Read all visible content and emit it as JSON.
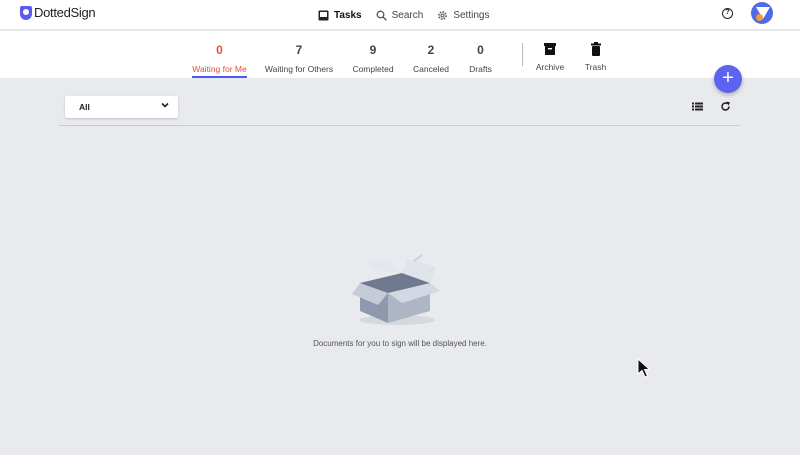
{
  "app": {
    "logo_prefix": "Dotted",
    "logo_suffix": "Sign"
  },
  "nav": [
    {
      "label": "Tasks",
      "icon": "inbox-icon",
      "active": true
    },
    {
      "label": "Search",
      "icon": "search-icon",
      "active": false
    },
    {
      "label": "Settings",
      "icon": "gear-icon",
      "active": false
    }
  ],
  "header_right": {
    "help_icon": "help-circle-icon",
    "help_glyph": "?",
    "avatar": "user-avatar"
  },
  "tabs": [
    {
      "count": "0",
      "label": "Waiting for Me",
      "active": true
    },
    {
      "count": "7",
      "label": "Waiting for Others",
      "active": false
    },
    {
      "count": "9",
      "label": "Completed",
      "active": false
    },
    {
      "count": "2",
      "label": "Canceled",
      "active": false
    },
    {
      "count": "0",
      "label": "Drafts",
      "active": false
    }
  ],
  "tab_actions": [
    {
      "label": "Archive",
      "icon": "archive-icon"
    },
    {
      "label": "Trash",
      "icon": "trash-icon"
    }
  ],
  "fab": {
    "glyph": "+",
    "icon": "plus-icon"
  },
  "filter": {
    "value": "All"
  },
  "toolbar": {
    "list_icon": "list-view-icon",
    "refresh_icon": "refresh-icon"
  },
  "empty_state": {
    "message": "Documents for you to sign will be displayed here.",
    "illustration": "empty-box-illustration"
  },
  "colors": {
    "accent": "#5b63f0",
    "active_tab": "#e0503d",
    "background": "#e8eaee"
  }
}
